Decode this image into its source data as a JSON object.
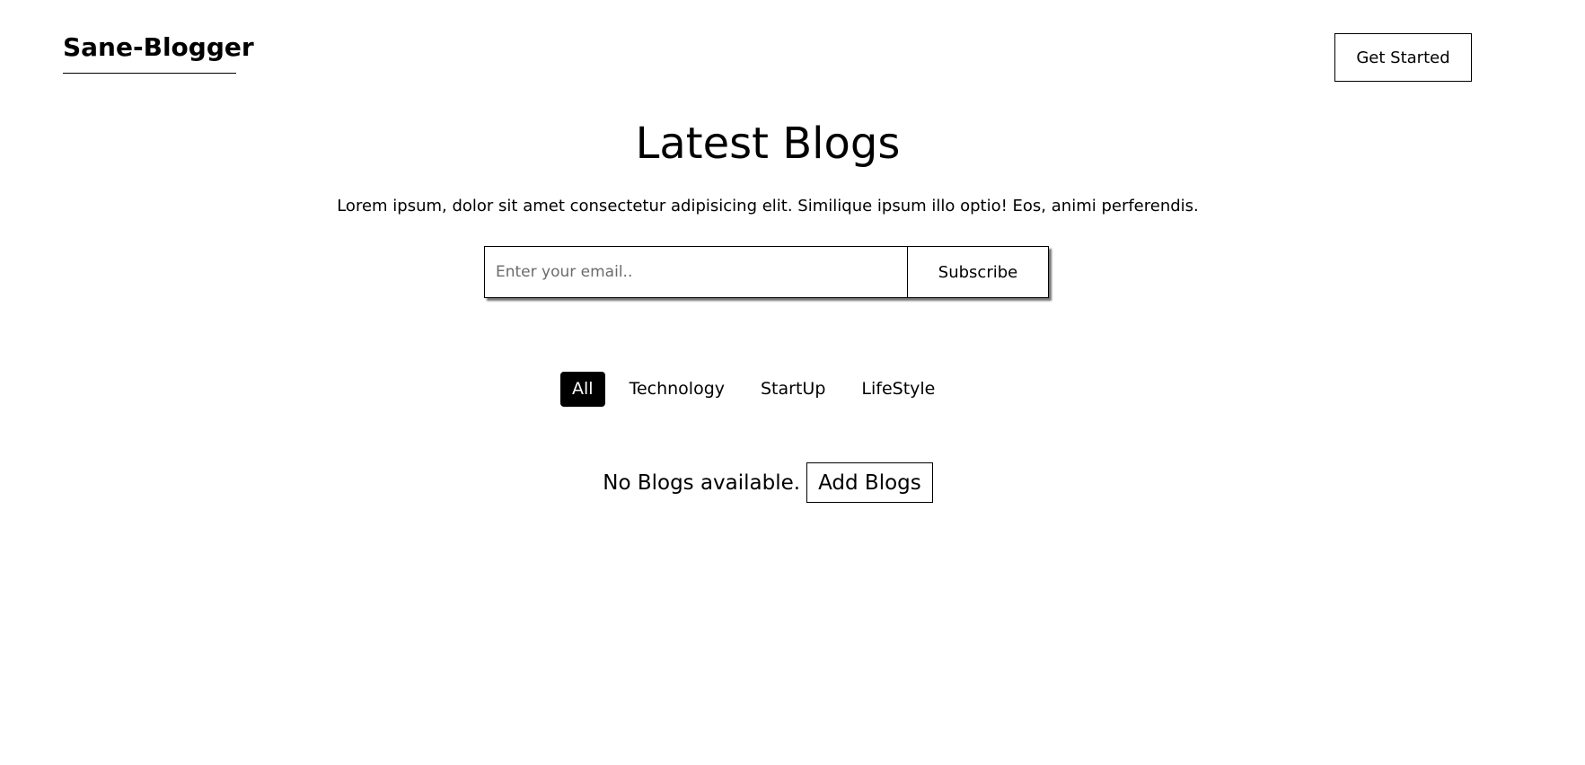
{
  "header": {
    "logo": "Sane-Blogger",
    "cta_label": "Get Started"
  },
  "hero": {
    "title": "Latest Blogs",
    "subtitle": "Lorem ipsum, dolor sit amet consectetur adipisicing elit. Similique ipsum illo optio! Eos, animi perferendis."
  },
  "subscribe": {
    "email_placeholder": "Enter your email..",
    "email_value": "",
    "button_label": "Subscribe"
  },
  "filters": {
    "tabs": [
      {
        "label": "All",
        "active": true
      },
      {
        "label": "Technology",
        "active": false
      },
      {
        "label": "StartUp",
        "active": false
      },
      {
        "label": "LifeStyle",
        "active": false
      }
    ]
  },
  "empty_state": {
    "message": "No Blogs available.",
    "button_label": "Add Blogs"
  }
}
